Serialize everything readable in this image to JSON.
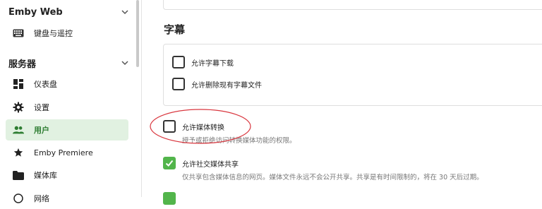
{
  "sidebar": {
    "group1_title": "Emby Web",
    "group1_items": [
      {
        "label": "键盘与遥控",
        "icon": "keyboard-icon"
      }
    ],
    "group2_title": "服务器",
    "group2_items": [
      {
        "label": "仪表盘",
        "icon": "dashboard-icon"
      },
      {
        "label": "设置",
        "icon": "gear-icon"
      },
      {
        "label": "用户",
        "icon": "people-icon",
        "active": true
      },
      {
        "label": "Emby Premiere",
        "icon": "star-icon"
      },
      {
        "label": "媒体库",
        "icon": "folder-icon"
      }
    ],
    "partial_item_label": "网络"
  },
  "main": {
    "subtitles_title": "字幕",
    "allow_subtitle_download": {
      "label": "允许字幕下载",
      "checked": false
    },
    "allow_subtitle_delete": {
      "label": "允许删除现有字幕文件",
      "checked": false
    },
    "allow_media_conversion": {
      "label": "允许媒体转换",
      "checked": false,
      "description": "授予或拒绝访问转换媒体功能的权限。"
    },
    "allow_social_sharing": {
      "label": "允许社交媒体共享",
      "checked": true,
      "description": "仅共享包含媒体信息的网页。媒体文件永远不会公开共享。共享是有时间限制的，将在 30 天后过期。"
    }
  },
  "colors": {
    "accent": "#52b54b",
    "active_bg": "#e1f1e1",
    "active_text": "#2e7d32",
    "annotation": "#d9363e"
  }
}
